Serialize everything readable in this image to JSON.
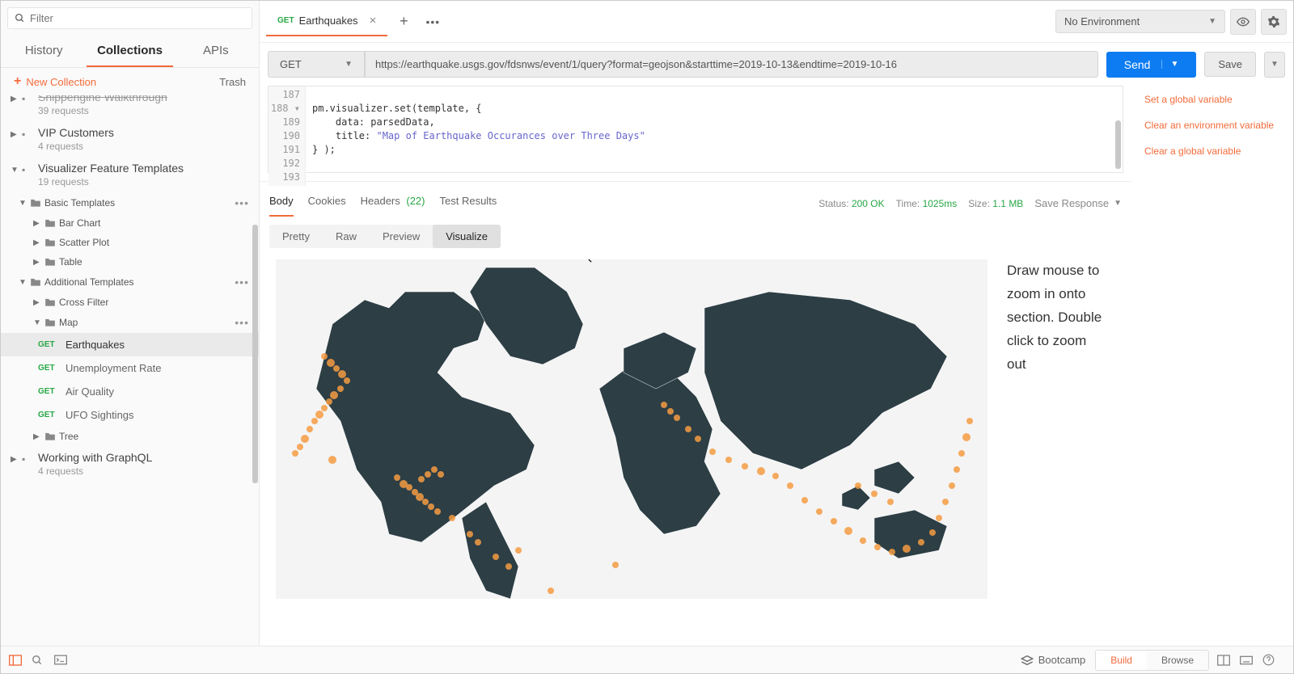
{
  "sidebar": {
    "filter_placeholder": "Filter",
    "tabs": {
      "history": "History",
      "collections": "Collections",
      "apis": "APIs"
    },
    "new_collection": "New Collection",
    "trash": "Trash",
    "collections": [
      {
        "name": "Shippengine Walkthrough",
        "sub": "39 requests",
        "truncated": true
      },
      {
        "name": "VIP Customers",
        "sub": "4 requests"
      },
      {
        "name": "Visualizer Feature Templates",
        "sub": "19 requests"
      },
      {
        "name": "Working with GraphQL",
        "sub": "4 requests"
      }
    ],
    "folders": {
      "basic": {
        "label": "Basic Templates",
        "children": [
          "Bar Chart",
          "Scatter Plot",
          "Table"
        ]
      },
      "additional": {
        "label": "Additional Templates",
        "cross_filter": "Cross Filter",
        "map": "Map",
        "tree": "Tree"
      },
      "map_requests": [
        {
          "method": "GET",
          "name": "Earthquakes"
        },
        {
          "method": "GET",
          "name": "Unemployment Rate"
        },
        {
          "method": "GET",
          "name": "Air Quality"
        },
        {
          "method": "GET",
          "name": "UFO Sightings"
        }
      ]
    }
  },
  "tab": {
    "method": "GET",
    "name": "Earthquakes"
  },
  "environment": {
    "selected": "No Environment"
  },
  "request": {
    "method": "GET",
    "url": "https://earthquake.usgs.gov/fdsnws/event/1/query?format=geojson&starttime=2019-10-13&endtime=2019-10-16",
    "send": "Send",
    "save": "Save"
  },
  "code": {
    "lines": [
      "187",
      "188",
      "189",
      "190",
      "191",
      "192",
      "193"
    ],
    "l187": "",
    "l188a": "pm.visualizer.set(template, {",
    "l189": "    data: parsedData,",
    "l190a": "    title: ",
    "l190b": "\"Map of Earthquake Occurances over Three Days\"",
    "l191": "} );",
    "l192": "",
    "l193": ""
  },
  "snippets": {
    "s1": "Set a global variable",
    "s2": "Clear an environment variable",
    "s3": "Clear a global variable"
  },
  "response": {
    "tabs": {
      "body": "Body",
      "cookies": "Cookies",
      "headers": "Headers",
      "headers_count": "(22)",
      "tests": "Test Results"
    },
    "status_label": "Status:",
    "status_val": "200 OK",
    "time_label": "Time:",
    "time_val": "1025ms",
    "size_label": "Size:",
    "size_val": "1.1 MB",
    "save": "Save Response",
    "view_tabs": {
      "pretty": "Pretty",
      "raw": "Raw",
      "preview": "Preview",
      "visualize": "Visualize"
    }
  },
  "viz_hint": "Draw mouse to zoom in onto section. Double click to zoom out",
  "footer": {
    "bootcamp": "Bootcamp",
    "build": "Build",
    "browse": "Browse"
  }
}
